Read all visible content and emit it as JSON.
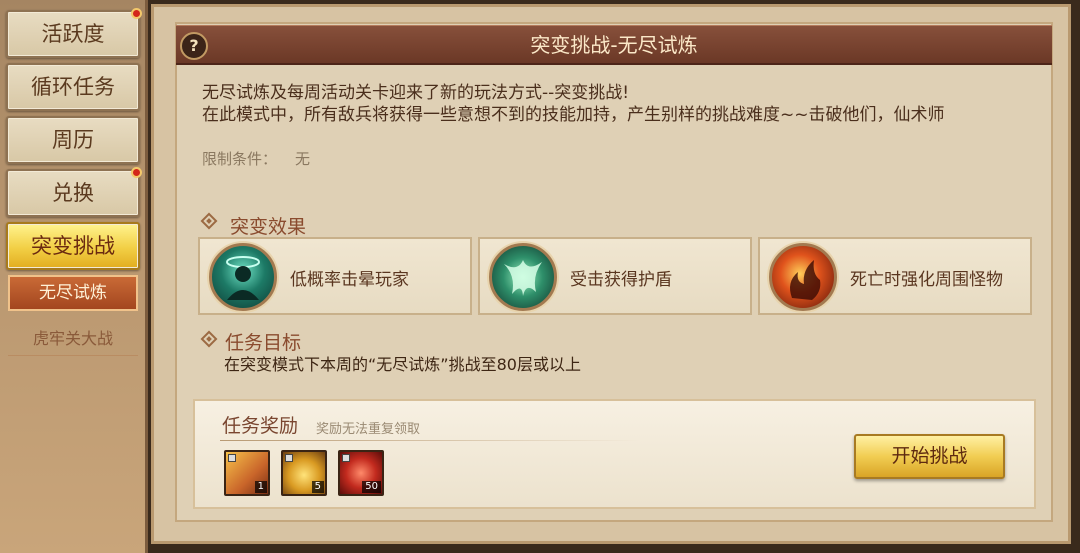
{
  "sidebar": {
    "items": [
      {
        "label": "活跃度",
        "red_dot": true
      },
      {
        "label": "循环任务",
        "red_dot": false
      },
      {
        "label": "周历",
        "red_dot": false
      },
      {
        "label": "兑换",
        "red_dot": true
      },
      {
        "label": "突变挑战",
        "red_dot": false,
        "active": true
      }
    ],
    "sub_items": [
      {
        "label": "无尽试炼",
        "selected": true
      },
      {
        "label": "虎牢关大战",
        "selected": false
      }
    ]
  },
  "panel": {
    "title": "突变挑战-无尽试炼",
    "help_label": "?",
    "description_lines": [
      "无尽试炼及每周活动关卡迎来了新的玩法方式--突变挑战!",
      "在此模式中，所有敌兵将获得一些意想不到的技能加持，产生别样的挑战难度~~击破他们，仙术师"
    ],
    "condition_label": "限制条件：",
    "condition_value": "无"
  },
  "mutation": {
    "title": "突变效果",
    "effects": [
      {
        "label": "低概率击晕玩家",
        "icon": "stun-aura-icon"
      },
      {
        "label": "受击获得护盾",
        "icon": "shield-spirit-icon"
      },
      {
        "label": "死亡时强化周围怪物",
        "icon": "fire-empower-icon"
      }
    ]
  },
  "goal": {
    "title": "任务目标",
    "text": "在突变模式下本周的“无尽试炼”挑战至80层或以上"
  },
  "reward": {
    "title": "任务奖励",
    "note": "奖励无法重复领取",
    "items": [
      {
        "icon": "scroll-item-icon",
        "count": "1"
      },
      {
        "icon": "gold-ore-item-icon",
        "count": "5"
      },
      {
        "icon": "red-pouch-item-icon",
        "count": "50"
      }
    ],
    "start_label": "开始挑战"
  },
  "colors": {
    "title_bar": "#7a4230",
    "active_tab": "#f2cf45",
    "sub_selected": "#b5542a",
    "start_button": "#f1cd52"
  }
}
